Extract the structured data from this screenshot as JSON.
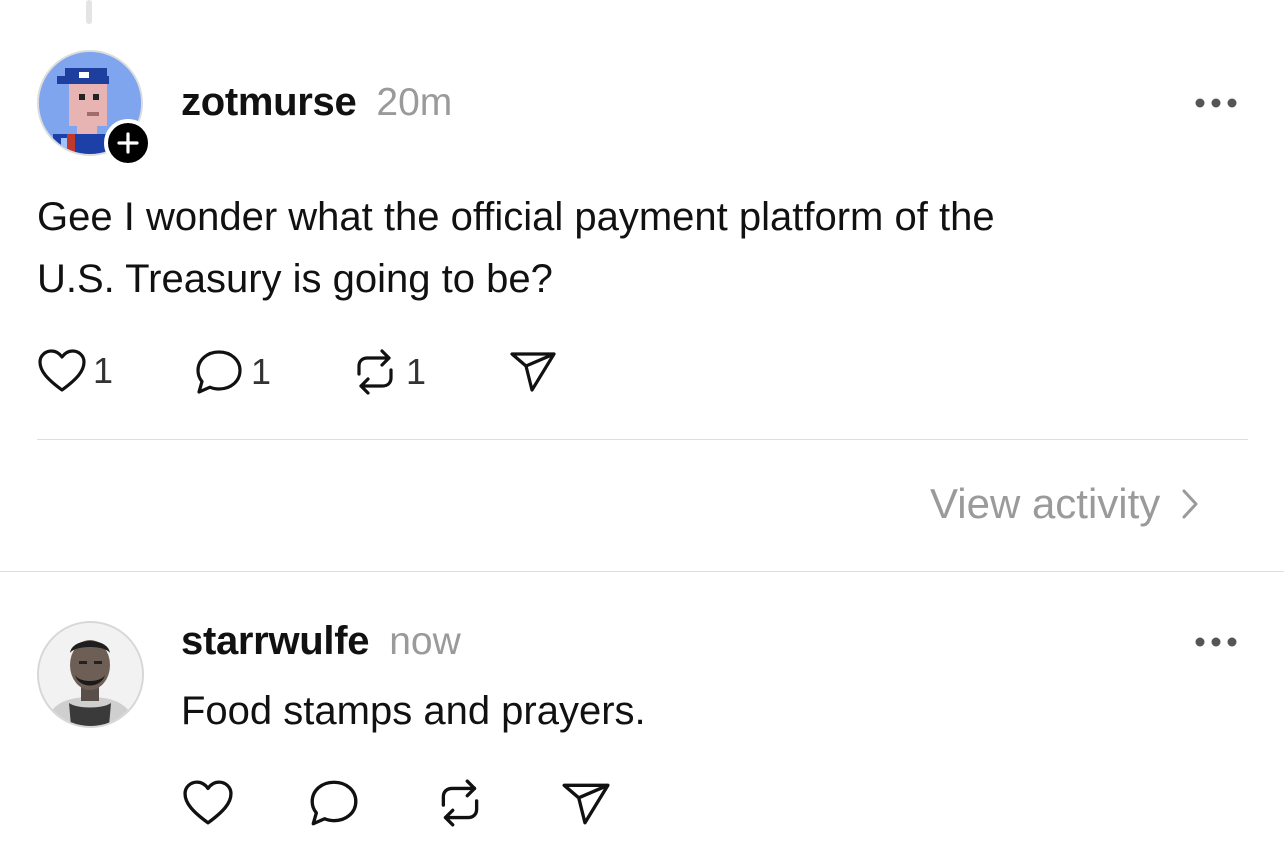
{
  "post": {
    "username": "zotmurse",
    "time": "20m",
    "text_line1": "Gee I wonder what the official payment platform of the",
    "text_line2": "U.S. Treasury is going to be?",
    "likes": "1",
    "replies": "1",
    "reposts": "1"
  },
  "view_activity": "View activity",
  "reply": {
    "username": "starrwulfe",
    "time": "now",
    "text": "Food stamps and prayers."
  },
  "icons": {
    "more": "more-horizontal-icon",
    "like": "heart-icon",
    "reply": "speech-bubble-icon",
    "repost": "repost-icon",
    "share": "paper-plane-icon",
    "follow": "plus-icon",
    "chevron": "chevron-right-icon"
  }
}
